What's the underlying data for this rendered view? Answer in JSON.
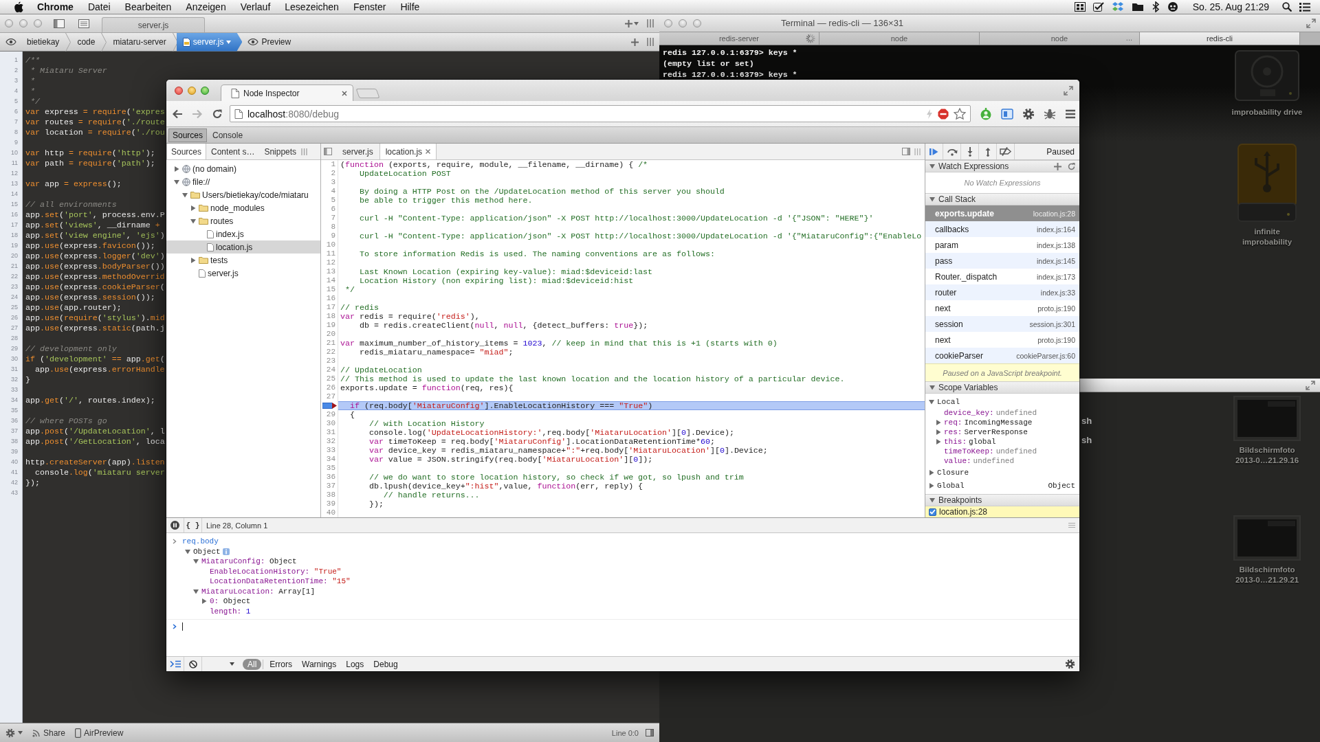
{
  "menu_bar": {
    "app": "Chrome",
    "menus": [
      "Datei",
      "Bearbeiten",
      "Anzeigen",
      "Verlauf",
      "Lesezeichen",
      "Fenster",
      "Hilfe"
    ],
    "clock": "So. 25. Aug 21:29"
  },
  "editor_window": {
    "title": "server.js",
    "breadcrumbs": [
      {
        "label": "bietiekay",
        "selected": false
      },
      {
        "label": "code",
        "selected": false
      },
      {
        "label": "miataru-server",
        "selected": false
      },
      {
        "label": "server.js",
        "selected": true
      }
    ],
    "preview": "Preview",
    "lines": [
      {
        "n": "1",
        "parts": [
          {
            "kind": "comment",
            "text": "/**"
          }
        ]
      },
      {
        "n": "2",
        "parts": [
          {
            "kind": "comment",
            "text": " * Miataru Server"
          }
        ]
      },
      {
        "n": "3",
        "parts": [
          {
            "kind": "comment",
            "text": " *"
          }
        ]
      },
      {
        "n": "4",
        "parts": [
          {
            "kind": "comment",
            "text": " *"
          }
        ]
      },
      {
        "n": "5",
        "parts": [
          {
            "kind": "comment",
            "text": " */"
          }
        ]
      },
      {
        "n": "6",
        "parts": [
          {
            "kind": "keyword",
            "text": "var"
          },
          {
            "kind": "plain",
            "text": " express "
          },
          {
            "kind": "keyword",
            "text": "= require"
          },
          {
            "kind": "plain",
            "text": "("
          },
          {
            "kind": "string",
            "text": "'expres"
          }
        ]
      },
      {
        "n": "7",
        "parts": [
          {
            "kind": "keyword",
            "text": "var"
          },
          {
            "kind": "plain",
            "text": " routes "
          },
          {
            "kind": "keyword",
            "text": "= require"
          },
          {
            "kind": "plain",
            "text": "("
          },
          {
            "kind": "string",
            "text": "'./route"
          }
        ]
      },
      {
        "n": "8",
        "parts": [
          {
            "kind": "keyword",
            "text": "var"
          },
          {
            "kind": "plain",
            "text": " location "
          },
          {
            "kind": "keyword",
            "text": "= require"
          },
          {
            "kind": "plain",
            "text": "("
          },
          {
            "kind": "string",
            "text": "'./rou"
          }
        ]
      },
      {
        "n": "9"
      },
      {
        "n": "10",
        "parts": [
          {
            "kind": "keyword",
            "text": "var"
          },
          {
            "kind": "plain",
            "text": " http "
          },
          {
            "kind": "keyword",
            "text": "= require"
          },
          {
            "kind": "plain",
            "text": "("
          },
          {
            "kind": "string",
            "text": "'http'"
          },
          {
            "kind": "plain",
            "text": ");"
          }
        ]
      },
      {
        "n": "11",
        "parts": [
          {
            "kind": "keyword",
            "text": "var"
          },
          {
            "kind": "plain",
            "text": " path "
          },
          {
            "kind": "keyword",
            "text": "= require"
          },
          {
            "kind": "plain",
            "text": "("
          },
          {
            "kind": "string",
            "text": "'path'"
          },
          {
            "kind": "plain",
            "text": ");"
          }
        ]
      },
      {
        "n": "12"
      },
      {
        "n": "13",
        "parts": [
          {
            "kind": "keyword",
            "text": "var"
          },
          {
            "kind": "plain",
            "text": " app "
          },
          {
            "kind": "keyword",
            "text": "= express"
          },
          {
            "kind": "plain",
            "text": "();"
          }
        ]
      },
      {
        "n": "14"
      },
      {
        "n": "15",
        "parts": [
          {
            "kind": "comment",
            "text": "// all environments"
          }
        ]
      },
      {
        "n": "16",
        "parts": [
          {
            "kind": "plain",
            "text": "app"
          },
          {
            "kind": "keyword",
            "text": ".set"
          },
          {
            "kind": "plain",
            "text": "("
          },
          {
            "kind": "string",
            "text": "'port'"
          },
          {
            "kind": "plain",
            "text": ", process.env.P"
          }
        ]
      },
      {
        "n": "17",
        "parts": [
          {
            "kind": "plain",
            "text": "app"
          },
          {
            "kind": "keyword",
            "text": ".set"
          },
          {
            "kind": "plain",
            "text": "("
          },
          {
            "kind": "string",
            "text": "'views'"
          },
          {
            "kind": "plain",
            "text": ", __dirname "
          },
          {
            "kind": "keyword",
            "text": "+"
          }
        ]
      },
      {
        "n": "18",
        "parts": [
          {
            "kind": "plain",
            "text": "app"
          },
          {
            "kind": "keyword",
            "text": ".set"
          },
          {
            "kind": "plain",
            "text": "("
          },
          {
            "kind": "string",
            "text": "'view engine'"
          },
          {
            "kind": "plain",
            "text": ", "
          },
          {
            "kind": "string",
            "text": "'ejs'"
          },
          {
            "kind": "plain",
            "text": ")"
          }
        ]
      },
      {
        "n": "19",
        "parts": [
          {
            "kind": "plain",
            "text": "app"
          },
          {
            "kind": "keyword",
            "text": ".use"
          },
          {
            "kind": "plain",
            "text": "(express"
          },
          {
            "kind": "keyword",
            "text": ".favicon"
          },
          {
            "kind": "plain",
            "text": "());"
          }
        ]
      },
      {
        "n": "20",
        "parts": [
          {
            "kind": "plain",
            "text": "app"
          },
          {
            "kind": "keyword",
            "text": ".use"
          },
          {
            "kind": "plain",
            "text": "(express"
          },
          {
            "kind": "keyword",
            "text": ".logger"
          },
          {
            "kind": "plain",
            "text": "("
          },
          {
            "kind": "string",
            "text": "'dev'"
          },
          {
            "kind": "plain",
            "text": ")"
          }
        ]
      },
      {
        "n": "21",
        "parts": [
          {
            "kind": "plain",
            "text": "app"
          },
          {
            "kind": "keyword",
            "text": ".use"
          },
          {
            "kind": "plain",
            "text": "(express"
          },
          {
            "kind": "keyword",
            "text": ".bodyParser"
          },
          {
            "kind": "plain",
            "text": "())"
          }
        ]
      },
      {
        "n": "22",
        "parts": [
          {
            "kind": "plain",
            "text": "app"
          },
          {
            "kind": "keyword",
            "text": ".use"
          },
          {
            "kind": "plain",
            "text": "(express"
          },
          {
            "kind": "keyword",
            "text": ".methodOverrid"
          }
        ]
      },
      {
        "n": "23",
        "parts": [
          {
            "kind": "plain",
            "text": "app"
          },
          {
            "kind": "keyword",
            "text": ".use"
          },
          {
            "kind": "plain",
            "text": "(express"
          },
          {
            "kind": "keyword",
            "text": ".cookieParser"
          },
          {
            "kind": "plain",
            "text": "("
          }
        ]
      },
      {
        "n": "24",
        "parts": [
          {
            "kind": "plain",
            "text": "app"
          },
          {
            "kind": "keyword",
            "text": ".use"
          },
          {
            "kind": "plain",
            "text": "(express"
          },
          {
            "kind": "keyword",
            "text": ".session"
          },
          {
            "kind": "plain",
            "text": "());"
          }
        ]
      },
      {
        "n": "25",
        "parts": [
          {
            "kind": "plain",
            "text": "app"
          },
          {
            "kind": "keyword",
            "text": ".use"
          },
          {
            "kind": "plain",
            "text": "(app.router);"
          }
        ]
      },
      {
        "n": "26",
        "parts": [
          {
            "kind": "plain",
            "text": "app"
          },
          {
            "kind": "keyword",
            "text": ".use"
          },
          {
            "kind": "plain",
            "text": "("
          },
          {
            "kind": "keyword",
            "text": "require"
          },
          {
            "kind": "plain",
            "text": "("
          },
          {
            "kind": "string",
            "text": "'stylus'"
          },
          {
            "kind": "plain",
            "text": ")."
          },
          {
            "kind": "keyword",
            "text": "mid"
          }
        ]
      },
      {
        "n": "27",
        "parts": [
          {
            "kind": "plain",
            "text": "app"
          },
          {
            "kind": "keyword",
            "text": ".use"
          },
          {
            "kind": "plain",
            "text": "(express"
          },
          {
            "kind": "keyword",
            "text": ".static"
          },
          {
            "kind": "plain",
            "text": "(path.j"
          }
        ]
      },
      {
        "n": "28"
      },
      {
        "n": "29",
        "parts": [
          {
            "kind": "comment",
            "text": "// development only"
          }
        ]
      },
      {
        "n": "30",
        "parts": [
          {
            "kind": "keyword",
            "text": "if"
          },
          {
            "kind": "plain",
            "text": " ("
          },
          {
            "kind": "string",
            "text": "'development'"
          },
          {
            "kind": "keyword",
            "text": " =="
          },
          {
            "kind": "plain",
            "text": " app"
          },
          {
            "kind": "keyword",
            "text": ".get"
          },
          {
            "kind": "plain",
            "text": "("
          }
        ]
      },
      {
        "n": "31",
        "parts": [
          {
            "kind": "plain",
            "text": "  app"
          },
          {
            "kind": "keyword",
            "text": ".use"
          },
          {
            "kind": "plain",
            "text": "(express"
          },
          {
            "kind": "keyword",
            "text": ".errorHandle"
          }
        ]
      },
      {
        "n": "32",
        "parts": [
          {
            "kind": "plain",
            "text": "}"
          }
        ]
      },
      {
        "n": "33"
      },
      {
        "n": "34",
        "parts": [
          {
            "kind": "plain",
            "text": "app"
          },
          {
            "kind": "keyword",
            "text": ".get"
          },
          {
            "kind": "plain",
            "text": "("
          },
          {
            "kind": "string",
            "text": "'/'"
          },
          {
            "kind": "plain",
            "text": ", routes.index);"
          }
        ]
      },
      {
        "n": "35"
      },
      {
        "n": "36",
        "parts": [
          {
            "kind": "comment",
            "text": "// where POSTs go"
          }
        ]
      },
      {
        "n": "37",
        "parts": [
          {
            "kind": "plain",
            "text": "app"
          },
          {
            "kind": "keyword",
            "text": ".post"
          },
          {
            "kind": "plain",
            "text": "("
          },
          {
            "kind": "string",
            "text": "'/UpdateLocation'"
          },
          {
            "kind": "plain",
            "text": ", l"
          }
        ]
      },
      {
        "n": "38",
        "parts": [
          {
            "kind": "plain",
            "text": "app"
          },
          {
            "kind": "keyword",
            "text": ".post"
          },
          {
            "kind": "plain",
            "text": "("
          },
          {
            "kind": "string",
            "text": "'/GetLocation'"
          },
          {
            "kind": "plain",
            "text": ", loca"
          }
        ]
      },
      {
        "n": "39"
      },
      {
        "n": "40",
        "parts": [
          {
            "kind": "plain",
            "text": "http"
          },
          {
            "kind": "keyword",
            "text": ".createServer"
          },
          {
            "kind": "plain",
            "text": "(app)"
          },
          {
            "kind": "keyword",
            "text": ".listen"
          }
        ]
      },
      {
        "n": "41",
        "parts": [
          {
            "kind": "plain",
            "text": "  console"
          },
          {
            "kind": "keyword",
            "text": ".log"
          },
          {
            "kind": "plain",
            "text": "("
          },
          {
            "kind": "string",
            "text": "'miataru server"
          }
        ]
      },
      {
        "n": "42",
        "parts": [
          {
            "kind": "plain",
            "text": "});"
          }
        ]
      },
      {
        "n": "43"
      }
    ],
    "status_bar": {
      "share": "Share",
      "air_preview": "AirPreview",
      "position": "Line 0:0"
    }
  },
  "terminal": {
    "title": "Terminal — redis-cli — 136×31",
    "tabs": [
      {
        "label": "redis-server",
        "selected": false,
        "busy": true
      },
      {
        "label": "node",
        "selected": false,
        "busy": false
      },
      {
        "label": "node",
        "selected": false,
        "busy": false,
        "indicator": "..."
      },
      {
        "label": "redis-cli",
        "selected": true,
        "busy": false
      }
    ],
    "output": [
      "redis 127.0.0.1:6379> keys *",
      "(empty list or set)",
      "redis 127.0.0.1:6379> keys *"
    ]
  },
  "terminal_2": {
    "output": [
      "sh",
      "sh"
    ]
  },
  "desktop_icons": [
    {
      "kind": "drive",
      "label": "improbability drive"
    },
    {
      "kind": "usb_drive",
      "label": "infinite improbability"
    },
    {
      "kind": "screenshot",
      "label": "Bildschirmfoto 2013-0…21.29.16"
    },
    {
      "kind": "screenshot",
      "label": "Bildschirmfoto 2013-0…21.29.21"
    }
  ],
  "inspector": {
    "tab_title": "Node Inspector",
    "url": {
      "host": "localhost",
      "path": ":8080/debug"
    },
    "panel_tabs": [
      {
        "label": "Sources",
        "selected": true
      },
      {
        "label": "Console",
        "selected": false
      }
    ],
    "navigator": {
      "tabs": [
        {
          "label": "Sources",
          "selected": true
        },
        {
          "label": "Content s…",
          "selected": false
        },
        {
          "label": "Snippets",
          "selected": false
        }
      ],
      "tree": [
        {
          "label": "(no domain)",
          "kind": "domain",
          "expanded": false,
          "selected": false
        },
        {
          "label": "file://",
          "kind": "domain",
          "expanded": true,
          "selected": false,
          "children": [
            {
              "label": "Users/bietiekay/code/miataru",
              "kind": "folder",
              "expanded": true,
              "selected": false,
              "children": [
                {
                  "label": "node_modules",
                  "kind": "folder",
                  "expanded": false,
                  "selected": false
                },
                {
                  "label": "routes",
                  "kind": "folder",
                  "expanded": true,
                  "selected": false,
                  "children": [
                    {
                      "label": "index.js",
                      "kind": "file",
                      "selected": false
                    },
                    {
                      "label": "location.js",
                      "kind": "file",
                      "selected": true
                    }
                  ]
                },
                {
                  "label": "tests",
                  "kind": "folder",
                  "expanded": false,
                  "selected": false
                },
                {
                  "label": "server.js",
                  "kind": "file",
                  "selected": false
                }
              ]
            }
          ]
        }
      ]
    },
    "editor": {
      "tabs": [
        {
          "label": "server.js",
          "selected": false
        },
        {
          "label": "location.js",
          "selected": true
        }
      ],
      "lines": [
        {
          "n": "1",
          "paused": false,
          "parts": [
            {
              "kind": "plain",
              "text": "("
            },
            {
              "kind": "keyword",
              "text": "function"
            },
            {
              "kind": "plain",
              "text": " (exports, require, module, __filename, __dirname) { "
            },
            {
              "kind": "comment",
              "text": "/*"
            }
          ]
        },
        {
          "n": "2",
          "paused": false,
          "parts": [
            {
              "kind": "comment",
              "text": "    UpdateLocation POST"
            }
          ]
        },
        {
          "n": "3",
          "paused": false
        },
        {
          "n": "4",
          "paused": false,
          "parts": [
            {
              "kind": "comment",
              "text": "    By doing a HTTP Post on the /UpdateLocation method of this server you should"
            }
          ]
        },
        {
          "n": "5",
          "paused": false,
          "parts": [
            {
              "kind": "comment",
              "text": "    be able to trigger this method here."
            }
          ]
        },
        {
          "n": "6",
          "paused": false
        },
        {
          "n": "7",
          "paused": false,
          "parts": [
            {
              "kind": "comment",
              "text": "    curl -H \"Content-Type: application/json\" -X POST http://localhost:3000/UpdateLocation -d '{\"JSON\": \"HERE\"}'"
            }
          ]
        },
        {
          "n": "8",
          "paused": false
        },
        {
          "n": "9",
          "paused": false,
          "parts": [
            {
              "kind": "comment",
              "text": "    curl -H \"Content-Type: application/json\" -X POST http://localhost:3000/UpdateLocation -d '{\"MiataruConfig\":{\"EnableLo"
            }
          ]
        },
        {
          "n": "10",
          "paused": false
        },
        {
          "n": "11",
          "paused": false,
          "parts": [
            {
              "kind": "comment",
              "text": "    To store information Redis is used. The naming conventions are as follows:"
            }
          ]
        },
        {
          "n": "12",
          "paused": false
        },
        {
          "n": "13",
          "paused": false,
          "parts": [
            {
              "kind": "comment",
              "text": "    Last Known Location (expiring key-value): miad:$deviceid:last"
            }
          ]
        },
        {
          "n": "14",
          "paused": false,
          "parts": [
            {
              "kind": "comment",
              "text": "    Location History (non expiring list): miad:$deviceid:hist"
            }
          ]
        },
        {
          "n": "15",
          "paused": false,
          "parts": [
            {
              "kind": "comment",
              "text": " */"
            }
          ]
        },
        {
          "n": "16",
          "paused": false
        },
        {
          "n": "17",
          "paused": false,
          "parts": [
            {
              "kind": "comment",
              "text": "// redis"
            }
          ]
        },
        {
          "n": "18",
          "paused": false,
          "parts": [
            {
              "kind": "keyword",
              "text": "var"
            },
            {
              "kind": "plain",
              "text": " redis = require("
            },
            {
              "kind": "string",
              "text": "'redis'"
            },
            {
              "kind": "plain",
              "text": "),"
            }
          ]
        },
        {
          "n": "19",
          "paused": false,
          "parts": [
            {
              "kind": "plain",
              "text": "    db = redis.createClient("
            },
            {
              "kind": "keyword",
              "text": "null"
            },
            {
              "kind": "plain",
              "text": ", "
            },
            {
              "kind": "keyword",
              "text": "null"
            },
            {
              "kind": "plain",
              "text": ", {detect_buffers: "
            },
            {
              "kind": "keyword",
              "text": "true"
            },
            {
              "kind": "plain",
              "text": "});"
            }
          ]
        },
        {
          "n": "20",
          "paused": false
        },
        {
          "n": "21",
          "paused": false,
          "parts": [
            {
              "kind": "keyword",
              "text": "var"
            },
            {
              "kind": "plain",
              "text": " maximum_number_of_history_items = "
            },
            {
              "kind": "number",
              "text": "1023"
            },
            {
              "kind": "plain",
              "text": ", "
            },
            {
              "kind": "comment",
              "text": "// keep in mind that this is +1 (starts with 0)"
            }
          ]
        },
        {
          "n": "22",
          "paused": false,
          "parts": [
            {
              "kind": "plain",
              "text": "    redis_miataru_namespace= "
            },
            {
              "kind": "string",
              "text": "\"miad\""
            },
            {
              "kind": "plain",
              "text": ";"
            }
          ]
        },
        {
          "n": "23",
          "paused": false
        },
        {
          "n": "24",
          "paused": false,
          "parts": [
            {
              "kind": "comment",
              "text": "// UpdateLocation"
            }
          ]
        },
        {
          "n": "25",
          "paused": false,
          "parts": [
            {
              "kind": "comment",
              "text": "// This method is used to update the last known location and the location history of a particular device."
            }
          ]
        },
        {
          "n": "26",
          "paused": false,
          "parts": [
            {
              "kind": "plain",
              "text": "exports.update = "
            },
            {
              "kind": "keyword",
              "text": "function"
            },
            {
              "kind": "plain",
              "text": "(req, res){"
            }
          ]
        },
        {
          "n": "27",
          "paused": false
        },
        {
          "paused": true,
          "parts": [
            {
              "kind": "keyword",
              "text": "  if"
            },
            {
              "kind": "plain",
              "text": " (req.body["
            },
            {
              "kind": "string",
              "text": "'MiataruConfig'"
            },
            {
              "kind": "plain",
              "text": "].EnableLocationHistory === "
            },
            {
              "kind": "string",
              "text": "\"True\""
            },
            {
              "kind": "plain",
              "text": ")"
            }
          ]
        },
        {
          "n": "29",
          "paused": false,
          "parts": [
            {
              "kind": "plain",
              "text": "  {"
            }
          ]
        },
        {
          "n": "30",
          "paused": false,
          "parts": [
            {
              "kind": "comment",
              "text": "      // with Location History"
            }
          ]
        },
        {
          "n": "31",
          "paused": false,
          "parts": [
            {
              "kind": "plain",
              "text": "      console.log("
            },
            {
              "kind": "string",
              "text": "'UpdateLocationHistory:'"
            },
            {
              "kind": "plain",
              "text": ",req.body["
            },
            {
              "kind": "string",
              "text": "'MiataruLocation'"
            },
            {
              "kind": "plain",
              "text": "]["
            },
            {
              "kind": "number",
              "text": "0"
            },
            {
              "kind": "plain",
              "text": "].Device);"
            }
          ]
        },
        {
          "n": "32",
          "paused": false,
          "parts": [
            {
              "kind": "keyword",
              "text": "      var"
            },
            {
              "kind": "plain",
              "text": " timeToKeep = req.body["
            },
            {
              "kind": "string",
              "text": "'MiataruConfig'"
            },
            {
              "kind": "plain",
              "text": "].LocationDataRetentionTime*"
            },
            {
              "kind": "number",
              "text": "60"
            },
            {
              "kind": "plain",
              "text": ";"
            }
          ]
        },
        {
          "n": "33",
          "paused": false,
          "parts": [
            {
              "kind": "keyword",
              "text": "      var"
            },
            {
              "kind": "plain",
              "text": " device_key = redis_miataru_namespace+"
            },
            {
              "kind": "string",
              "text": "\":\""
            },
            {
              "kind": "plain",
              "text": "+req.body["
            },
            {
              "kind": "string",
              "text": "'MiataruLocation'"
            },
            {
              "kind": "plain",
              "text": "]["
            },
            {
              "kind": "number",
              "text": "0"
            },
            {
              "kind": "plain",
              "text": "].Device;"
            }
          ]
        },
        {
          "n": "34",
          "paused": false,
          "parts": [
            {
              "kind": "keyword",
              "text": "      var"
            },
            {
              "kind": "plain",
              "text": " value = JSON.stringify(req.body["
            },
            {
              "kind": "string",
              "text": "'MiataruLocation'"
            },
            {
              "kind": "plain",
              "text": "]["
            },
            {
              "kind": "number",
              "text": "0"
            },
            {
              "kind": "plain",
              "text": "]);"
            }
          ]
        },
        {
          "n": "35",
          "paused": false
        },
        {
          "n": "36",
          "paused": false,
          "parts": [
            {
              "kind": "comment",
              "text": "      // we do want to store location history, so check if we got, so lpush and trim"
            }
          ]
        },
        {
          "n": "37",
          "paused": false,
          "parts": [
            {
              "kind": "plain",
              "text": "      db.lpush(device_key+"
            },
            {
              "kind": "string",
              "text": "\":hist\""
            },
            {
              "kind": "plain",
              "text": ",value, "
            },
            {
              "kind": "keyword",
              "text": "function"
            },
            {
              "kind": "plain",
              "text": "(err, reply) {"
            }
          ]
        },
        {
          "n": "38",
          "paused": false,
          "parts": [
            {
              "kind": "comment",
              "text": "         // handle returns..."
            }
          ]
        },
        {
          "n": "39",
          "paused": false,
          "parts": [
            {
              "kind": "plain",
              "text": "      });"
            }
          ]
        },
        {
          "n": "40",
          "paused": false
        }
      ]
    },
    "sidebar": {
      "status": "Paused",
      "watch": {
        "title": "Watch Expressions",
        "expanded": true,
        "empty_text": "No Watch Expressions"
      },
      "call_stack": {
        "title": "Call Stack",
        "expanded": true,
        "frames": [
          {
            "name": "exports.update",
            "location": "location.js:28",
            "selected": true
          },
          {
            "name": "callbacks",
            "location": "index.js:164",
            "selected": false
          },
          {
            "name": "param",
            "location": "index.js:138",
            "selected": false
          },
          {
            "name": "pass",
            "location": "index.js:145",
            "selected": false
          },
          {
            "name": "Router._dispatch",
            "location": "index.js:173",
            "selected": false
          },
          {
            "name": "router",
            "location": "index.js:33",
            "selected": false
          },
          {
            "name": "next",
            "location": "proto.js:190",
            "selected": false
          },
          {
            "name": "session",
            "location": "session.js:301",
            "selected": false
          },
          {
            "name": "next",
            "location": "proto.js:190",
            "selected": false
          },
          {
            "name": "cookieParser",
            "location": "cookieParser.js:60",
            "selected": false
          }
        ]
      },
      "pause_message": "Paused on a JavaScript breakpoint.",
      "scope": {
        "title": "Scope Variables",
        "expanded": true,
        "scopes": [
          {
            "label": "Local",
            "expanded": true,
            "variables": [
              {
                "name": "device_key:",
                "value": "undefined",
                "kind": "value"
              },
              {
                "name": "req:",
                "value": "IncomingMessage",
                "kind": "object"
              },
              {
                "name": "res:",
                "value": "ServerResponse",
                "kind": "object"
              },
              {
                "name": "this:",
                "value": "global",
                "kind": "object"
              },
              {
                "name": "timeToKeep:",
                "value": "undefined",
                "kind": "value"
              },
              {
                "name": "value:",
                "value": "undefined",
                "kind": "value"
              }
            ]
          },
          {
            "label": "Closure",
            "expanded": false
          },
          {
            "label": "Global",
            "expanded": false,
            "value": "Object"
          }
        ]
      },
      "breakpoints": {
        "title": "Breakpoints",
        "expanded": true,
        "items": [
          {
            "label": "location.js:28",
            "checked": true
          }
        ]
      }
    },
    "console": {
      "position": "Line 28, Column 1",
      "format_button": "{ }",
      "command": "req.body",
      "result": {
        "value": "Object",
        "kind": "object",
        "expanded": true,
        "children": [
          {
            "key": "MiataruConfig:",
            "value": "Object",
            "kind": "object",
            "expanded": true,
            "children": [
              {
                "key": "EnableLocationHistory:",
                "value": "\"True\"",
                "kind": "string"
              },
              {
                "key": "LocationDataRetentionTime:",
                "value": "\"15\"",
                "kind": "string"
              }
            ]
          },
          {
            "key": "MiataruLocation:",
            "value": "Array[1]",
            "kind": "object",
            "expanded": true,
            "children": [
              {
                "key": "0:",
                "value": "Object",
                "kind": "object",
                "expanded": false
              },
              {
                "key": "length:",
                "value": "1",
                "kind": "number"
              }
            ]
          }
        ]
      },
      "filters": [
        {
          "label": "All",
          "selected": true
        },
        {
          "label": "Errors",
          "selected": false
        },
        {
          "label": "Warnings",
          "selected": false
        },
        {
          "label": "Logs",
          "selected": false
        },
        {
          "label": "Debug",
          "selected": false
        }
      ]
    }
  }
}
